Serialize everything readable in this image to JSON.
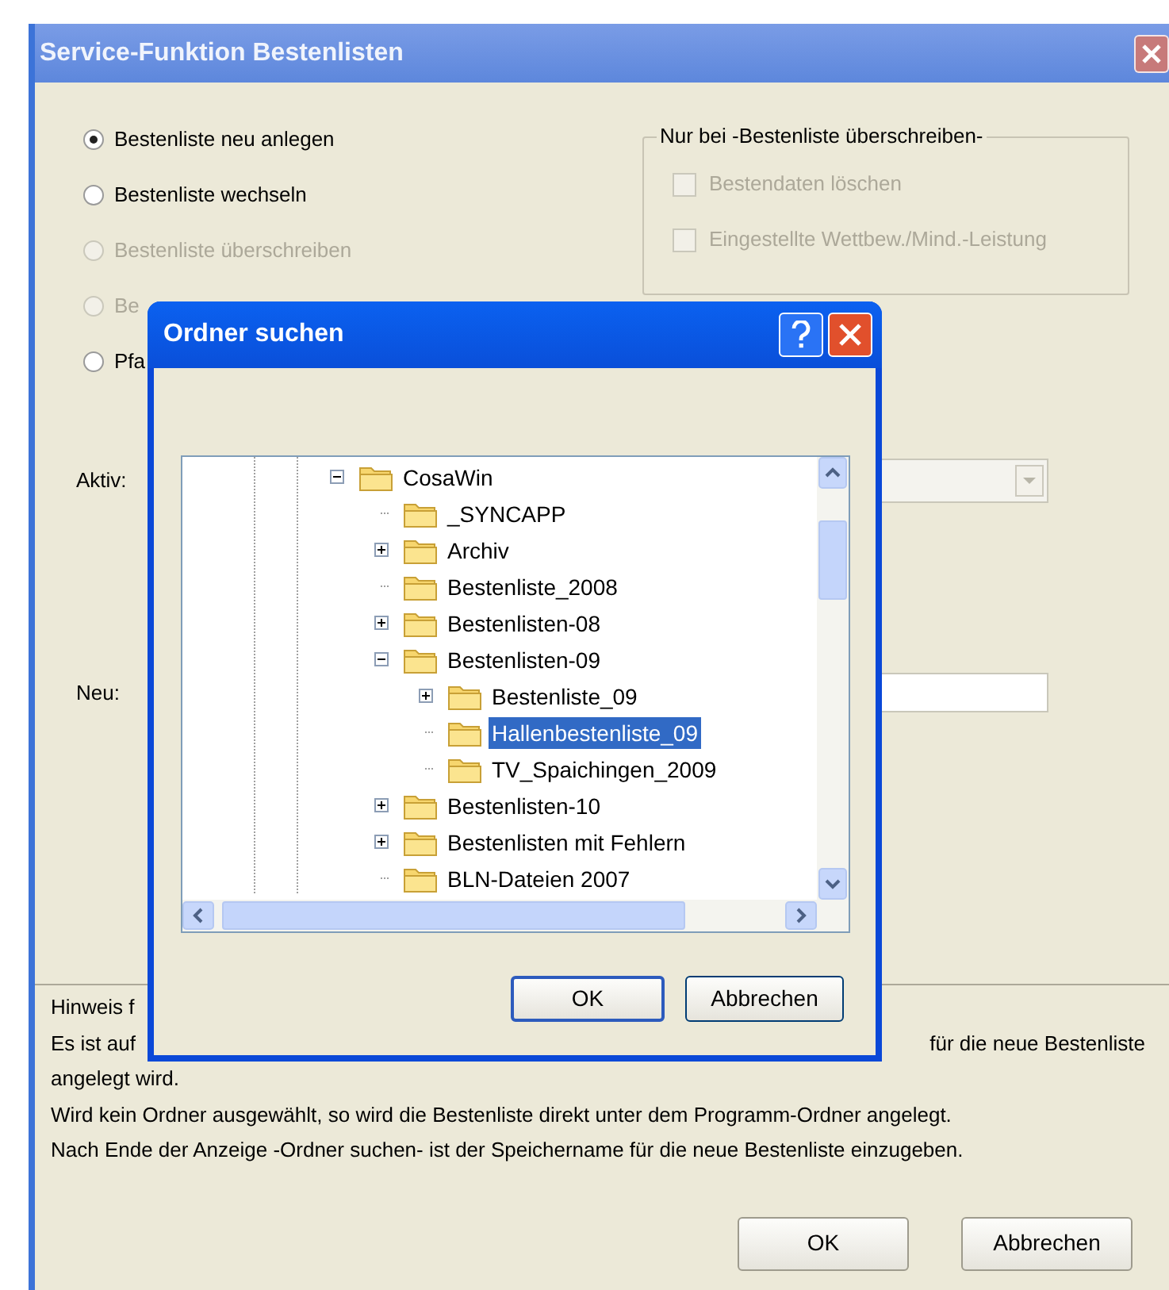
{
  "window": {
    "title": "Service-Funktion Bestenlisten"
  },
  "options": [
    {
      "label": "Bestenliste neu anlegen",
      "selected": true,
      "disabled": false
    },
    {
      "label": "Bestenliste wechseln",
      "selected": false,
      "disabled": false
    },
    {
      "label": "Bestenliste überschreiben",
      "selected": false,
      "disabled": true
    },
    {
      "label": "Be",
      "selected": false,
      "disabled": true
    },
    {
      "label": "Pfa",
      "selected": false,
      "disabled": false
    }
  ],
  "overwrite_group": {
    "title": "Nur bei -Bestenliste überschreiben-",
    "checkboxes": [
      {
        "label": "Bestendaten löschen",
        "checked": false,
        "disabled": true
      },
      {
        "label": "Eingestellte Wettbew./Mind.-Leistung",
        "checked": false,
        "disabled": true
      }
    ]
  },
  "active_label": "Aktiv:",
  "new_label": "Neu:",
  "hint": {
    "line_1": "Hinweis f",
    "line_2_start": "Es ist auf",
    "line_2_end": "für die neue Bestenliste",
    "lines": [
      "angelegt wird.",
      "Wird kein Ordner ausgewählt, so wird die Bestenliste direkt unter dem Programm-Ordner angelegt.",
      "Nach Ende der Anzeige -Ordner suchen- ist der Speichername für die neue Bestenliste einzugeben."
    ]
  },
  "buttons": [
    "OK",
    "Abbrechen"
  ],
  "dialog": {
    "title": "Ordner suchen",
    "tree": [
      {
        "label": "CosaWin",
        "expanded": true,
        "selected": false,
        "children": [
          {
            "label": "_SYNCAPP",
            "selected": false
          },
          {
            "label": "Archiv",
            "expanded": false,
            "selected": false
          },
          {
            "label": "Bestenliste_2008",
            "selected": false
          },
          {
            "label": "Bestenlisten-08",
            "expanded": false,
            "selected": false
          },
          {
            "label": "Bestenlisten-09",
            "expanded": true,
            "selected": false,
            "children": [
              {
                "label": "Bestenliste_09",
                "expanded": false,
                "selected": false
              },
              {
                "label": "Hallenbestenliste_09",
                "selected": true
              },
              {
                "label": "TV_Spaichingen_2009",
                "selected": false
              }
            ]
          },
          {
            "label": "Bestenlisten-10",
            "expanded": false,
            "selected": false
          },
          {
            "label": "Bestenlisten mit Fehlern",
            "expanded": false,
            "selected": false
          },
          {
            "label": "BLN-Dateien 2007",
            "selected": false
          }
        ]
      }
    ],
    "buttons": [
      "OK",
      "Abbrechen"
    ]
  }
}
